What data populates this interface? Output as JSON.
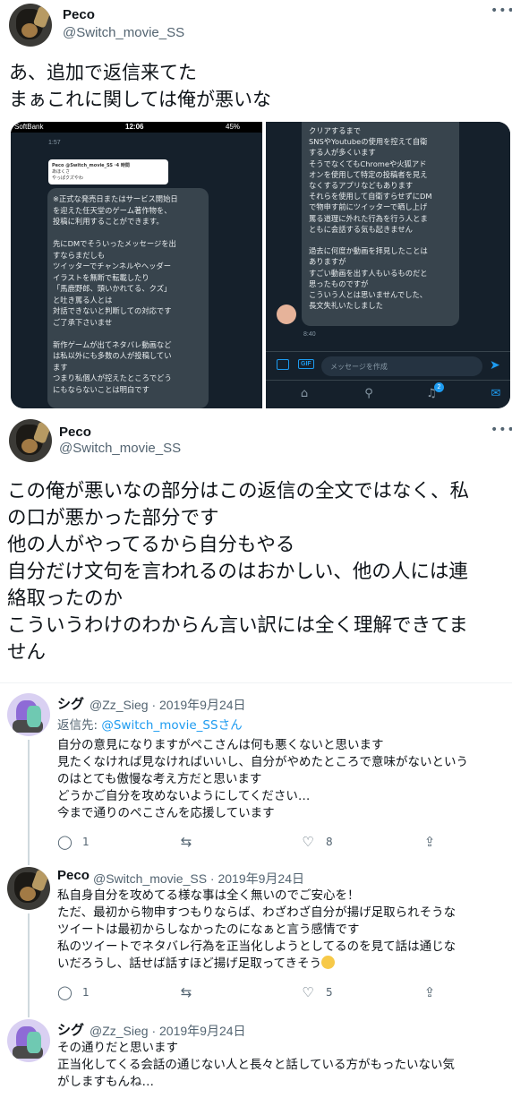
{
  "tweet1": {
    "name": "Peco",
    "handle": "@Switch_movie_SS",
    "text_lines": [
      "あ、追加で返信来てた",
      "まぁこれに関しては俺が悪いな"
    ]
  },
  "media": {
    "left": {
      "status_carrier": "SoftBank",
      "status_time": "12:06",
      "status_battery": "45%",
      "time_top": "1:57",
      "quote_name": "Peco @Switch_movie_SS ·4 時間",
      "quote_line1": "あほくさ",
      "quote_line2": "やっぱクズやわ",
      "bubble_lines": [
        "※正式な発売日またはサービス開始日",
        "を迎えた任天堂のゲーム著作物を、",
        "投稿に利用することができます。",
        "",
        "先にDMでそういったメッセージを出",
        "すならまだしも",
        "ツイッターでチャンネルやヘッダー",
        "イラストを無断で転載したり",
        "「馬鹿野郎、頭いかれてる、クズ」",
        "と吐き罵る人とは",
        "対話できないと判断しての対応です",
        "ご了承下さいませ",
        "",
        "新作ゲームが出てネタバレ動画など",
        "は私以外にも多数の人が投稿してい",
        "ます",
        "つまり私個人が控えたところでどう",
        "にもならないことは明白です"
      ]
    },
    "right": {
      "bubble_lines": [
        "クリアするまで",
        "SNSやYoutubeの使用を控えて自衛",
        "する人が多くいます",
        "そうでなくてもChromeや火狐アド",
        "オンを使用して特定の投稿者を見え",
        "なくするアプリなどもあります",
        "それらを使用して自衛すらせずにDM",
        "で物申す前にツイッターで晒し上げ",
        "罵る道理に外れた行為を行う人とま",
        "ともに会話する気も起きません",
        "",
        "過去に何度か動画を拝見したことは",
        "ありますが",
        "すごい動画を出す人もいるものだと",
        "思ったものですが",
        "こういう人とは思いませんでした、",
        "長文失礼いたしました"
      ],
      "time": "8:40",
      "compose_placeholder": "メッセージを作成",
      "notification_count": "2",
      "gif_label": "GIF"
    }
  },
  "tweet2": {
    "name": "Peco",
    "handle": "@Switch_movie_SS",
    "text_lines": [
      "この俺が悪いなの部分はこの返信の全文ではなく、私",
      "の口が悪かった部分です",
      "他の人がやってるから自分もやる",
      "自分だけ文句を言われるのはおかしい、他の人には連",
      "絡取ったのか",
      "こういうわけのわからん言い訳には全く理解できてま",
      "せん"
    ]
  },
  "replies": [
    {
      "name": "シグ",
      "meta": "@Zz_Sieg · 2019年9月24日",
      "reply_to_label": "返信先: ",
      "reply_to_mention": "@Switch_movie_SS",
      "reply_to_suffix": "さん",
      "lines": [
        "自分の意見になりますがぺこさんは何も悪くないと思います",
        "見たくなければ見なければいいし、自分がやめたところで意味がないという",
        "のはとても傲慢な考え方だと思います",
        "どうかご自分を攻めないようにしてください…",
        "今まで通りのぺこさんを応援しています"
      ],
      "reply_count": "1",
      "retweet_count": "",
      "like_count": "8"
    },
    {
      "name": "Peco",
      "meta": "@Switch_movie_SS · 2019年9月24日",
      "lines": [
        "私自身自分を攻めてる様な事は全く無いのでご安心を！",
        "ただ、最初から物申すつもりならば、わざわざ自分が揚げ足取られそうな",
        "ツイートは最初からしなかったのになぁと言う感情です",
        "私のツイートでネタバレ行為を正当化しようとしてるのを見て話は通じな",
        "いだろうし、話せば話すほど揚げ足取ってきそう"
      ],
      "reply_count": "1",
      "retweet_count": "",
      "like_count": "5"
    },
    {
      "name": "シグ",
      "meta": "@Zz_Sieg · 2019年9月24日",
      "lines": [
        "その通りだと思います",
        "正当化してくる会話の通じない人と長々と話している方がもったいない気",
        "がしますもんね…"
      ]
    }
  ],
  "icons": {
    "more": "more-icon",
    "reply": "reply-icon",
    "retweet": "retweet-icon",
    "like": "heart-icon",
    "share": "share-icon"
  },
  "colors": {
    "accent": "#1d9bf0",
    "dm_bg": "#15202b",
    "bubble": "#38444d"
  }
}
